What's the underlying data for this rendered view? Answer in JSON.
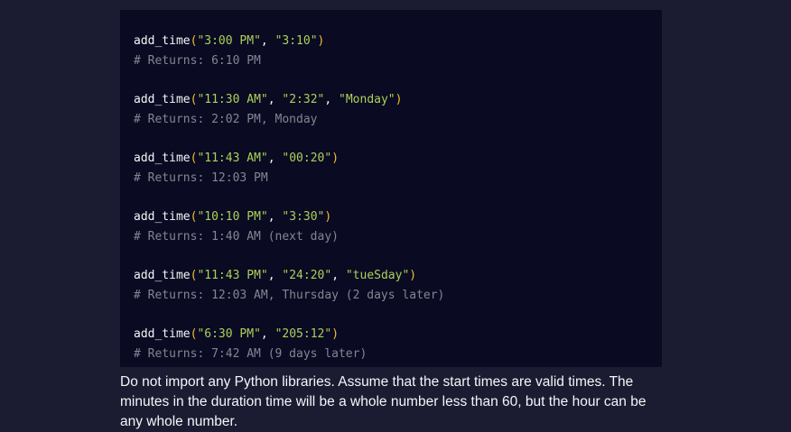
{
  "code_examples": [
    {
      "function_name": "add_time",
      "open_paren": "(",
      "close_paren": ")",
      "args": [
        "\"3:00 PM\"",
        "\"3:10\""
      ],
      "comment": "# Returns: 6:10 PM"
    },
    {
      "function_name": "add_time",
      "open_paren": "(",
      "close_paren": ")",
      "args": [
        "\"11:30 AM\"",
        "\"2:32\"",
        "\"Monday\""
      ],
      "comment": "# Returns: 2:02 PM, Monday"
    },
    {
      "function_name": "add_time",
      "open_paren": "(",
      "close_paren": ")",
      "args": [
        "\"11:43 AM\"",
        "\"00:20\""
      ],
      "comment": "# Returns: 12:03 PM"
    },
    {
      "function_name": "add_time",
      "open_paren": "(",
      "close_paren": ")",
      "args": [
        "\"10:10 PM\"",
        "\"3:30\""
      ],
      "comment": "# Returns: 1:40 AM (next day)"
    },
    {
      "function_name": "add_time",
      "open_paren": "(",
      "close_paren": ")",
      "args": [
        "\"11:43 PM\"",
        "\"24:20\"",
        "\"tueSday\""
      ],
      "comment": "# Returns: 12:03 AM, Thursday (2 days later)"
    },
    {
      "function_name": "add_time",
      "open_paren": "(",
      "close_paren": ")",
      "args": [
        "\"6:30 PM\"",
        "\"205:12\""
      ],
      "comment": "# Returns: 7:42 AM (9 days later)"
    }
  ],
  "arg_separator": ", ",
  "description": "Do not import any Python libraries. Assume that the start times are valid times. The minutes in the duration time will be a whole number less than 60, but the hour can be any whole number.",
  "colors": {
    "page_background": "#1b1b32",
    "code_background": "#0a0a23",
    "text": "#f5f6f7",
    "string": "#acd157",
    "parenthesis": "#f1be32",
    "comment": "#858591"
  }
}
